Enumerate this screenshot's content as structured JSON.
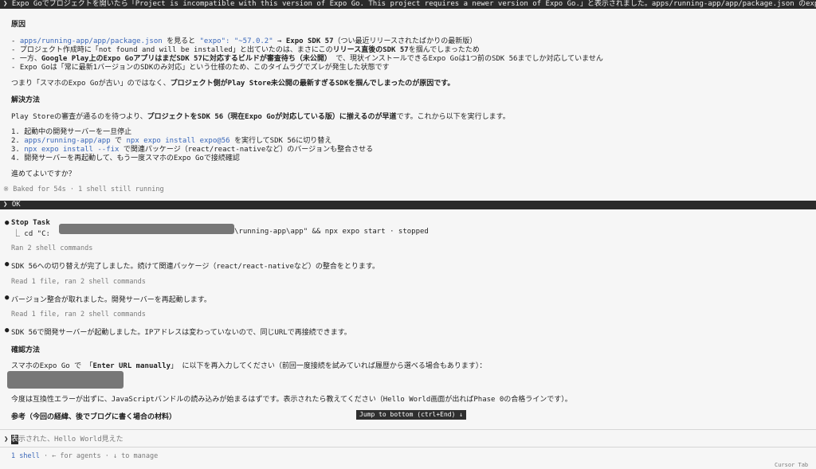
{
  "header": {
    "prompt_line": "❯ Expo Goでプロジェクトを開いたら「Project is incompatible with this version of Expo Go. This project requires a newer version of Expo Go.」と表示されました。apps/running-app/app/package.json のexpoのバージョンを…"
  },
  "cause": {
    "title": "原因",
    "bullets": [
      {
        "parts": [
          {
            "t": "- ",
            "c": ""
          },
          {
            "t": "apps/running-app/app/package.json",
            "c": "blue"
          },
          {
            "t": " を見ると ",
            "c": ""
          },
          {
            "t": "\"expo\": \"~57.0.2\"",
            "c": "blue"
          },
          {
            "t": " → ",
            "c": ""
          },
          {
            "t": "Expo SDK 57",
            "c": "b"
          },
          {
            "t": "（つい最近リリースされたばかりの最新版）",
            "c": ""
          }
        ]
      },
      {
        "parts": [
          {
            "t": "- プロジェクト作成時に「",
            "c": ""
          },
          {
            "t": "not found and will be installed",
            "c": ""
          },
          {
            "t": "」と出ていたのは、まさにこの",
            "c": ""
          },
          {
            "t": "リリース直後のSDK 57",
            "c": "b"
          },
          {
            "t": "を掴んでしまったため",
            "c": ""
          }
        ]
      },
      {
        "parts": [
          {
            "t": "- 一方、",
            "c": ""
          },
          {
            "t": "Google Play上のExpo GoアプリはまだSDK 57に対応するビルドが審査待ち（未公開）",
            "c": "b"
          },
          {
            "t": " で、現状インストールできるExpo Goは1つ前のSDK 56までしか対応していません",
            "c": ""
          }
        ]
      },
      {
        "parts": [
          {
            "t": "- Expo Goは「常に最新1バージョンのSDKのみ対応」という仕様のため、このタイムラグでズレが発生した状態です",
            "c": ""
          }
        ]
      }
    ],
    "summary_parts": [
      {
        "t": "つまり「スマホのExpo Goが古い」のではなく、",
        "c": ""
      },
      {
        "t": "プロジェクト側がPlay Store未公開の最新すぎるSDKを掴んでしまったのが原因です。",
        "c": "b"
      }
    ]
  },
  "solution": {
    "title": "解決方法",
    "intro_parts": [
      {
        "t": "Play Storeの審査が通るのを待つより、",
        "c": ""
      },
      {
        "t": "プロジェクトをSDK 56（現在Expo Goが対応している版）に揃えるのが早道",
        "c": "b"
      },
      {
        "t": "です。これから以下を実行します。",
        "c": ""
      }
    ],
    "steps": [
      {
        "parts": [
          {
            "t": "1. 起動中の開発サーバーを一旦停止",
            "c": ""
          }
        ]
      },
      {
        "parts": [
          {
            "t": "2. ",
            "c": ""
          },
          {
            "t": "apps/running-app/app",
            "c": "blue"
          },
          {
            "t": " で ",
            "c": ""
          },
          {
            "t": "npx expo install expo@56",
            "c": "blue"
          },
          {
            "t": " を実行してSDK 56に切り替え",
            "c": ""
          }
        ]
      },
      {
        "parts": [
          {
            "t": "3. ",
            "c": ""
          },
          {
            "t": "npx expo install --fix",
            "c": "blue"
          },
          {
            "t": " で関連パッケージ（react/react-nativeなど）のバージョンも整合させる",
            "c": ""
          }
        ]
      },
      {
        "parts": [
          {
            "t": "4. 開発サーバーを再起動して、もう一度スマホのExpo Goで接続確認",
            "c": ""
          }
        ]
      }
    ],
    "question": "進めてよいですか？"
  },
  "baked_status": "※ Baked for 54s · 1 shell still running",
  "user_reply": "❯ OK",
  "stop_task": {
    "title": "Stop Task",
    "cmd_prefix": "⎿  cd \"C:",
    "cmd_suffix": "\\running-app\\app\" && npx expo start · stopped"
  },
  "log": [
    {
      "kind": "gray",
      "text": "Ran 2 shell commands"
    },
    {
      "kind": "bullet",
      "text": "SDK 56への切り替えが完了しました。続けて関連パッケージ（react/react-nativeなど）の整合をとります。"
    },
    {
      "kind": "gray",
      "text": "Read 1 file, ran 2 shell commands"
    },
    {
      "kind": "bullet",
      "text": "バージョン整合が取れました。開発サーバーを再起動します。"
    },
    {
      "kind": "gray",
      "text": "Read 1 file, ran 2 shell commands"
    },
    {
      "kind": "bullet",
      "text": "SDK 56で開発サーバーが起動しました。IPアドレスは変わっていないので、同じURLで再接続できます。"
    }
  ],
  "verify": {
    "title": "確認方法",
    "instruction_parts": [
      {
        "t": "スマホのExpo Go で 「",
        "c": ""
      },
      {
        "t": "Enter URL manually",
        "c": "b"
      },
      {
        "t": "」 に以下を再入力してください（前回一度接続を試みていれば履歴から選べる場合もあります）：",
        "c": ""
      }
    ],
    "after": "今度は互換性エラーが出ずに、JavaScriptバンドルの読み込みが始まるはずです。表示されたら教えてください（Hello World画面が出ればPhase 0の合格ラインです）。"
  },
  "reference_title": "参考（今回の経緯、後でブログに書く場合の材料）",
  "jump_button": "Jump to bottom (ctrl+End) ↓",
  "input": {
    "prompt": "❯",
    "cursor_char": "表",
    "value": "示された、Hello World見えた"
  },
  "footer": {
    "shell": "1 shell",
    "hints": " · ← for agents · ↓ to manage",
    "right": "Cursor Tab"
  }
}
